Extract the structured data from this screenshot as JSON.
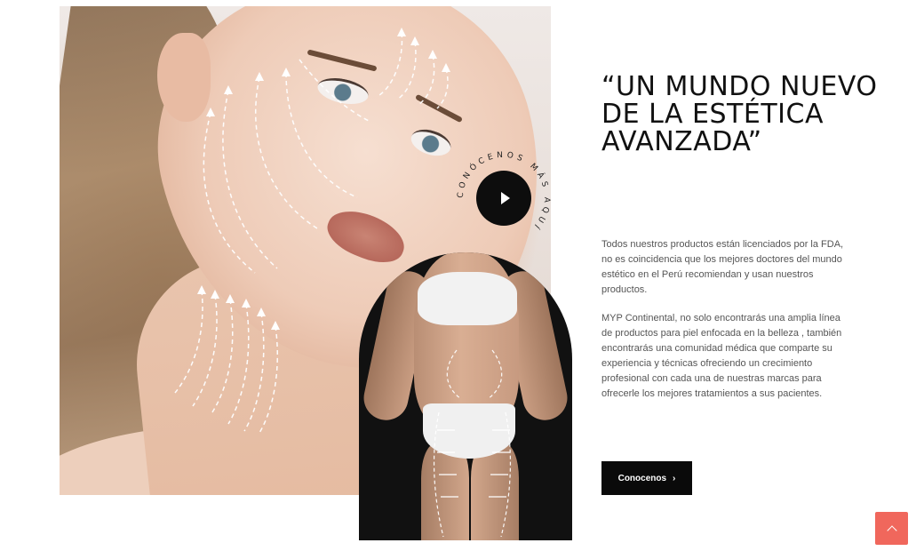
{
  "hero": {
    "face_image_alt": "",
    "body_image_alt": ""
  },
  "play_badge": {
    "ring_text": "CONÓCENOS MÁS AQUÍ",
    "icon": "play-icon"
  },
  "content": {
    "headline": "“UN MUNDO NUEVO DE LA ESTÉTICA AVANZADA”",
    "paragraph_1": "Todos nuestros productos están licenciados por la FDA, no es coincidencia que los mejores doctores del mundo estético en el Perú recomiendan y usan nuestros productos.",
    "paragraph_2": "MYP Continental, no solo encontrarás una amplia línea de productos para piel enfocada en la belleza , también encontrarás una comunidad médica que comparte su experiencia y técnicas ofreciendo un crecimiento profesional con cada una de nuestras marcas para ofrecerle los mejores tratamientos a sus pacientes.",
    "cta_label": "Conocenos",
    "cta_icon": "chevron-right-icon"
  },
  "back_to_top": {
    "icon": "chevron-up-icon"
  },
  "colors": {
    "accent": "#f0675c",
    "dark": "#0a0a0a",
    "text": "#555555"
  }
}
